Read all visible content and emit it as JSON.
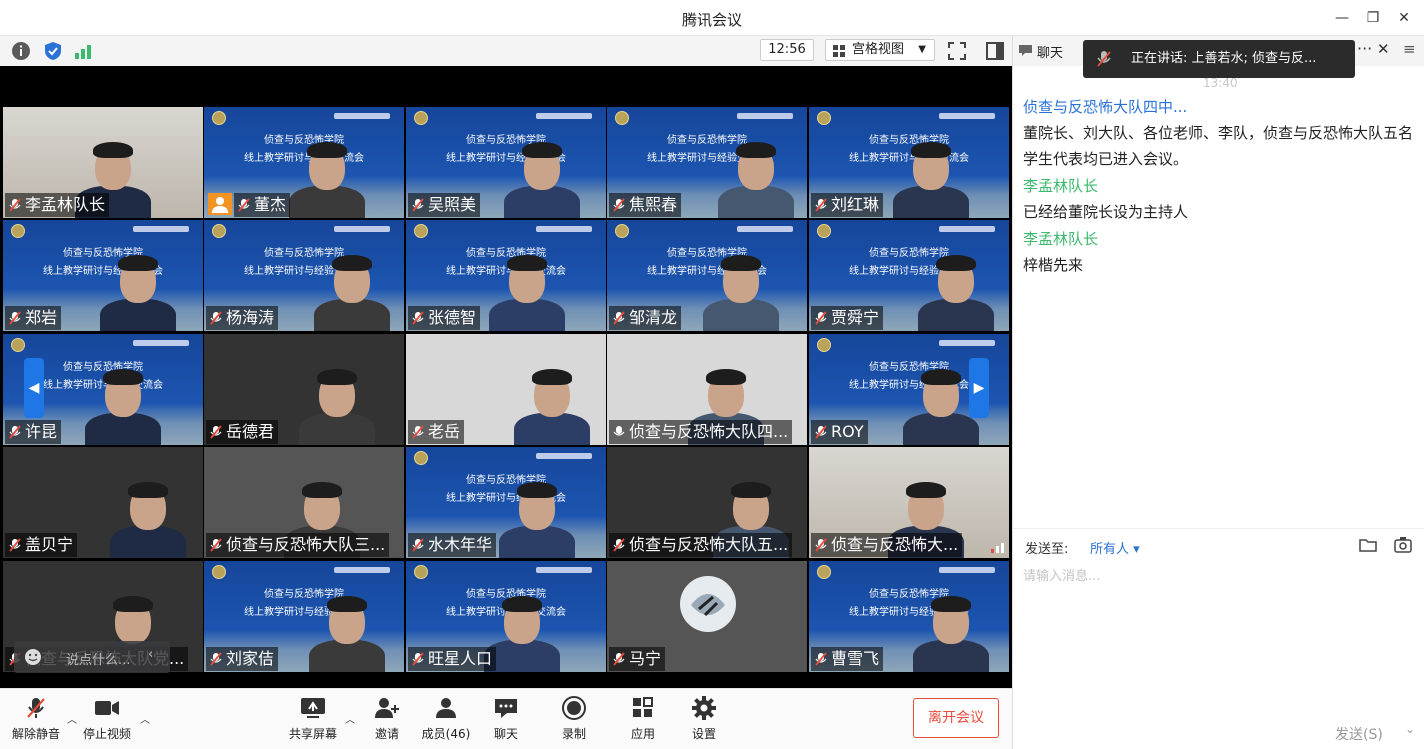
{
  "window": {
    "title": "腾讯会议"
  },
  "toolbar": {
    "time": "12:56",
    "view_label": "宫格视图"
  },
  "tiles": [
    {
      "name": "李孟林队长",
      "style": "room",
      "col": 0,
      "row": 0
    },
    {
      "name": "董杰",
      "style": "banner",
      "col": 1,
      "row": 0,
      "avatar": true
    },
    {
      "name": "吴照美",
      "style": "banner",
      "col": 2,
      "row": 0
    },
    {
      "name": "焦熙春",
      "style": "banner",
      "col": 3,
      "row": 0
    },
    {
      "name": "刘红琳",
      "style": "banner",
      "col": 4,
      "row": 0
    },
    {
      "name": "郑岩",
      "style": "banner",
      "col": 0,
      "row": 1
    },
    {
      "name": "杨海涛",
      "style": "banner",
      "col": 1,
      "row": 1
    },
    {
      "name": "张德智",
      "style": "banner",
      "col": 2,
      "row": 1
    },
    {
      "name": "邹清龙",
      "style": "banner",
      "col": 3,
      "row": 1
    },
    {
      "name": "贾舜宁",
      "style": "banner",
      "col": 4,
      "row": 1
    },
    {
      "name": "许昆",
      "style": "banner",
      "col": 0,
      "row": 2
    },
    {
      "name": "岳德君",
      "style": "dark",
      "col": 1,
      "row": 2
    },
    {
      "name": "老岳",
      "style": "light",
      "col": 2,
      "row": 2
    },
    {
      "name": "侦查与反恐怖大队四...",
      "style": "light",
      "col": 3,
      "row": 2,
      "mic_on": true
    },
    {
      "name": "ROY",
      "style": "banner",
      "col": 4,
      "row": 2
    },
    {
      "name": "盖贝宁",
      "style": "dark",
      "col": 0,
      "row": 3
    },
    {
      "name": "侦查与反恐怖大队三...",
      "style": "gray",
      "col": 1,
      "row": 3
    },
    {
      "name": "水木年华",
      "style": "banner",
      "col": 2,
      "row": 3
    },
    {
      "name": "侦查与反恐怖大队五...",
      "style": "dark",
      "col": 3,
      "row": 3
    },
    {
      "name": "侦查与反恐怖大...",
      "style": "room",
      "col": 4,
      "row": 3,
      "signal": true
    },
    {
      "name": "侦查与反恐怖大队党...",
      "style": "dark",
      "col": 0,
      "row": 4
    },
    {
      "name": "刘家佶",
      "style": "banner",
      "col": 1,
      "row": 4
    },
    {
      "name": "旺星人口",
      "style": "banner",
      "col": 2,
      "row": 4
    },
    {
      "name": "马宁",
      "style": "gray",
      "col": 3,
      "row": 4,
      "round_avatar": true
    },
    {
      "name": "曹雪飞",
      "style": "banner",
      "col": 4,
      "row": 4
    }
  ],
  "banner": {
    "line1": "侦查与反恐怖学院",
    "line2": "线上教学研讨与经验交流会"
  },
  "video_chat": {
    "placeholder": "说点什么..."
  },
  "bottom": {
    "unmute": "解除静音",
    "stop_video": "停止视频",
    "share": "共享屏幕",
    "invite": "邀请",
    "members": "成员(46)",
    "chat": "聊天",
    "record": "录制",
    "apps": "应用",
    "settings": "设置",
    "leave": "离开会议"
  },
  "chat": {
    "header": "聊天",
    "speaking": "正在讲话: 上善若水; 侦查与反...",
    "time": "13:40",
    "messages": [
      {
        "sender": "侦查与反恐怖大队四中...",
        "color": "blue",
        "text": "董院长、刘大队、各位老师、李队，侦查与反恐怖大队五名学生代表均已进入会议。"
      },
      {
        "sender": "李孟林队长",
        "color": "green",
        "text": "已经给董院长设为主持人"
      },
      {
        "sender": "李孟林队长",
        "color": "green",
        "text": "梓楷先来"
      }
    ],
    "send_to_label": "发送至:",
    "send_to_value": "所有人",
    "input_placeholder": "请输入消息...",
    "send_button": "发送(S)"
  }
}
